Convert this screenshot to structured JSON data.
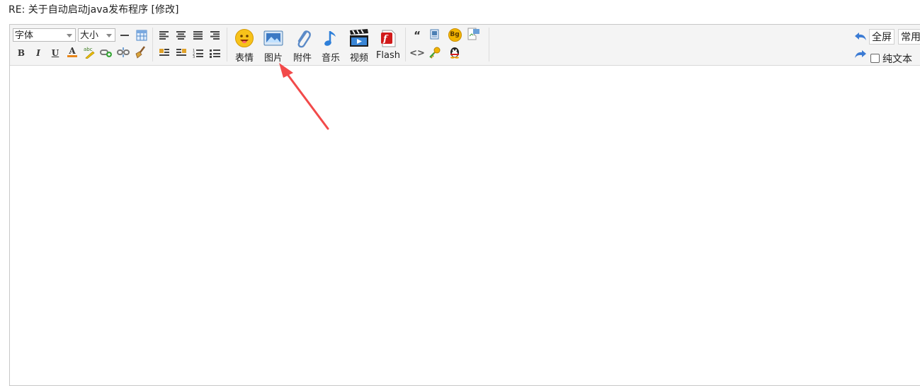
{
  "page": {
    "title": "RE: 关于自动启动java发布程序 [修改]"
  },
  "toolbar": {
    "font_select": "字体",
    "size_select": "大小",
    "bold": "B",
    "italic": "I",
    "underline": "U",
    "font_color": "A",
    "big_buttons": [
      {
        "name": "emoticon",
        "label": "表情",
        "icon": "smiley-icon"
      },
      {
        "name": "image",
        "label": "图片",
        "icon": "image-icon"
      },
      {
        "name": "attachment",
        "label": "附件",
        "icon": "paperclip-icon"
      },
      {
        "name": "music",
        "label": "音乐",
        "icon": "music-note-icon"
      },
      {
        "name": "video",
        "label": "视频",
        "icon": "clapperboard-icon"
      },
      {
        "name": "flash",
        "label": "Flash",
        "icon": "flash-icon"
      }
    ],
    "quote_glyph": "“",
    "code_glyph": "<>",
    "bg_badge": "Bg",
    "fullscreen": "全屏",
    "common": "常用",
    "plain_text": "纯文本"
  },
  "colors": {
    "toolbar_bg": "#f4f4f4",
    "accent_blue": "#3b7bd4",
    "annotation_arrow": "#f24a4a"
  }
}
